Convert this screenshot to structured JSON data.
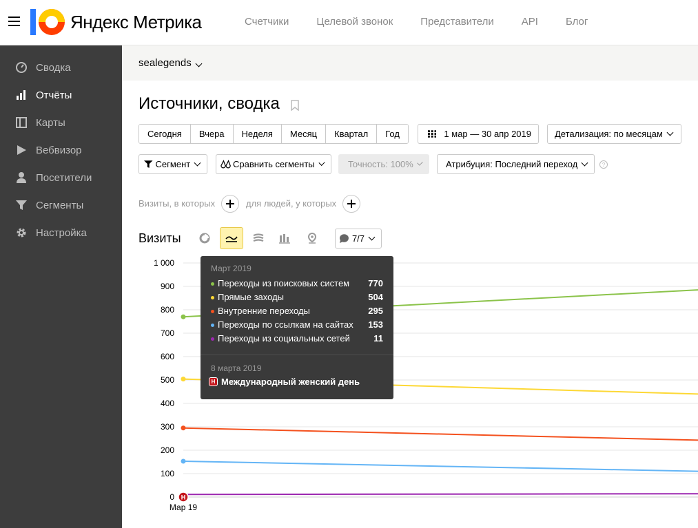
{
  "header": {
    "logo_text": "Яндекс Метрика",
    "nav": [
      "Счетчики",
      "Целевой звонок",
      "Представители",
      "API",
      "Блог"
    ]
  },
  "sidebar": {
    "items": [
      {
        "label": "Сводка",
        "icon": "gauge-icon"
      },
      {
        "label": "Отчёты",
        "icon": "bar-chart-icon",
        "active": true
      },
      {
        "label": "Карты",
        "icon": "map-icon"
      },
      {
        "label": "Вебвизор",
        "icon": "play-icon"
      },
      {
        "label": "Посетители",
        "icon": "user-icon"
      },
      {
        "label": "Сегменты",
        "icon": "filter-icon"
      },
      {
        "label": "Настройка",
        "icon": "gear-icon"
      }
    ]
  },
  "counter": {
    "name": "sealegends"
  },
  "page_title": "Источники, сводка",
  "periods": [
    "Сегодня",
    "Вчера",
    "Неделя",
    "Месяц",
    "Квартал",
    "Год"
  ],
  "date_range": "1 мар — 30 апр 2019",
  "detail": "Детализация: по месяцам",
  "segment": "Сегмент",
  "compare": "Сравнить сегменты",
  "accuracy": "Точность: 100%",
  "attribution": "Атрибуция: Последний переход",
  "help": "?",
  "seg_filter": {
    "visits_label": "Визиты, в которых",
    "people_label": "для людей, у которых"
  },
  "visits": {
    "title": "Визиты",
    "series_count": "7/7"
  },
  "chart_data": {
    "type": "line",
    "x": [
      "Мар 19"
    ],
    "ylim": [
      0,
      1000
    ],
    "yticks": [
      "0",
      "100",
      "200",
      "300",
      "400",
      "500",
      "600",
      "700",
      "800",
      "900",
      "1 000"
    ],
    "series": [
      {
        "name": "Переходы из поисковых систем",
        "color": "#8bc34a",
        "values": [
          770,
          885
        ]
      },
      {
        "name": "Прямые заходы",
        "color": "#fdd835",
        "values": [
          504,
          440
        ]
      },
      {
        "name": "Внутренние переходы",
        "color": "#f4511e",
        "values": [
          295,
          243
        ]
      },
      {
        "name": "Переходы по ссылкам на сайтах",
        "color": "#64b5f6",
        "values": [
          153,
          110
        ]
      },
      {
        "name": "Переходы из социальных сетей",
        "color": "#9c27b0",
        "values": [
          11,
          14
        ]
      }
    ]
  },
  "tooltip": {
    "header": "Март 2019",
    "rows": [
      {
        "name": "Переходы из поисковых систем",
        "value": "770",
        "color": "#8bc34a"
      },
      {
        "name": "Прямые заходы",
        "value": "504",
        "color": "#fdd835"
      },
      {
        "name": "Внутренние переходы",
        "value": "295",
        "color": "#f4511e"
      },
      {
        "name": "Переходы по ссылкам на сайтах",
        "value": "153",
        "color": "#64b5f6"
      },
      {
        "name": "Переходы из социальных сетей",
        "value": "11",
        "color": "#9c27b0"
      }
    ],
    "event_date": "8 марта 2019",
    "event_badge": "Н",
    "event_name": "Международный женский день"
  }
}
